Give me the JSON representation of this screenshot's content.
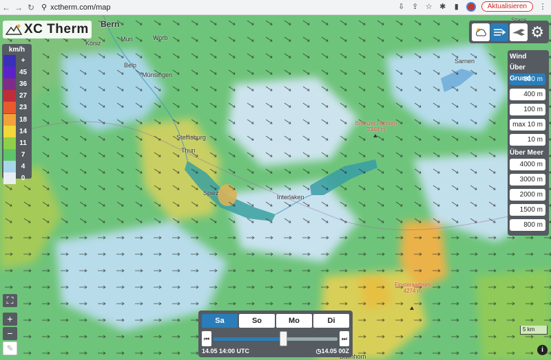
{
  "browser": {
    "url": "xctherm.com/map",
    "update_label": "Aktualisieren"
  },
  "app": {
    "logo_text": "XC Therm"
  },
  "legend": {
    "unit": "km/h",
    "items": [
      {
        "label": "+",
        "color": "#3a2fb8"
      },
      {
        "label": "45",
        "color": "#5a22c8"
      },
      {
        "label": "36",
        "color": "#7d2d88"
      },
      {
        "label": "27",
        "color": "#c02d3a"
      },
      {
        "label": "23",
        "color": "#e85a2d"
      },
      {
        "label": "18",
        "color": "#f2a23a"
      },
      {
        "label": "14",
        "color": "#f2d83a"
      },
      {
        "label": "11",
        "color": "#8ed048"
      },
      {
        "label": "7",
        "color": "#5ec46a"
      },
      {
        "label": "4",
        "color": "#a7d6e8"
      },
      {
        "label": "0",
        "color": "#e8eef2"
      }
    ]
  },
  "layers": {
    "icons": [
      "cloud-sun-icon",
      "wind-icon",
      "plane-icon",
      "gear-icon"
    ],
    "active": "wind-icon"
  },
  "altitude": {
    "title": "Wind",
    "above_ground_label": "Über Grund",
    "above_ground": [
      "800 m",
      "400 m",
      "100 m",
      "max 10 m",
      "10 m"
    ],
    "active": "800 m",
    "above_sea_label": "Über Meer",
    "above_sea": [
      "4000 m",
      "3000 m",
      "2000 m",
      "1500 m",
      "800 m"
    ]
  },
  "timeline": {
    "days": [
      "Sa",
      "So",
      "Mo",
      "Di"
    ],
    "active_day": "Sa",
    "current_time": "14.05 14:00 UTC",
    "run_label": "14.05 00Z",
    "position": 0.56
  },
  "map": {
    "scale_label": "5 km",
    "places": [
      "Bern",
      "Köniz",
      "Muri",
      "Worb",
      "Belp",
      "Münsingen",
      "Steffisburg",
      "Thun",
      "Spiez",
      "Interlaken",
      "Sarnen",
      "Stans",
      "Balmhorn"
    ],
    "peaks": [
      {
        "name": "Brienzer Rothorn",
        "elev": "2348 m"
      },
      {
        "name": "Finsteraarhorn",
        "elev": "4274 m"
      }
    ]
  },
  "zoom": {
    "in": "+",
    "out": "−"
  }
}
